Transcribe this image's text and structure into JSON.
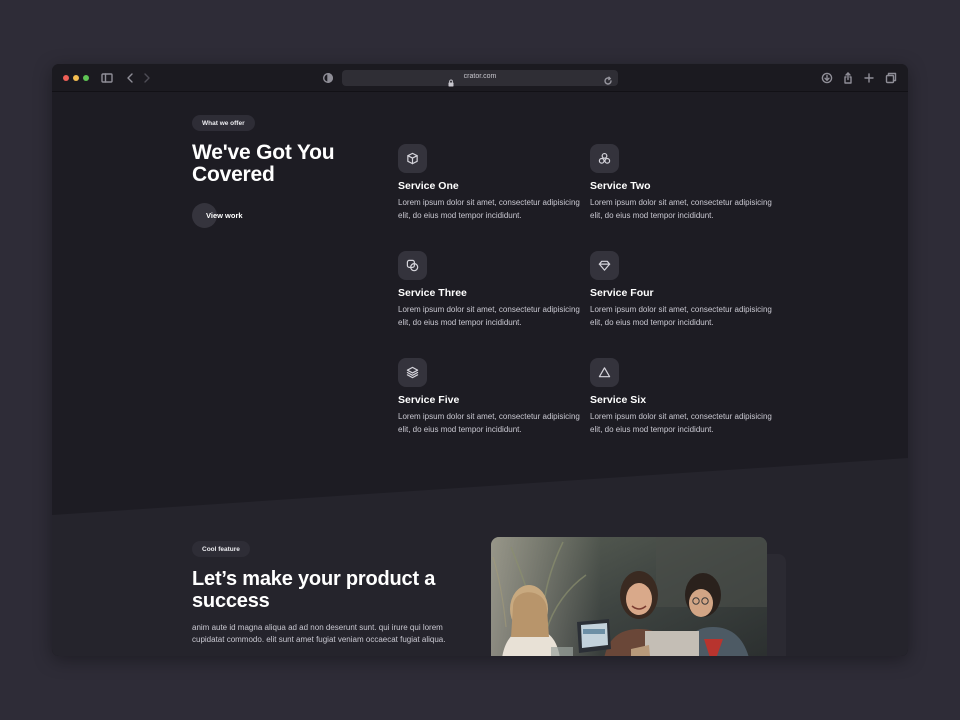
{
  "browser": {
    "url": "crator.com"
  },
  "hero": {
    "tag": "What we offer",
    "title": "We've Got You Covered",
    "button_label": "View work"
  },
  "services": [
    {
      "icon": "box-icon",
      "title": "Service One",
      "description": "Lorem ipsum dolor sit amet, consectetur adipisicing elit, do eius mod tempor incididunt."
    },
    {
      "icon": "circles-icon",
      "title": "Service Two",
      "description": "Lorem ipsum dolor sit amet, consectetur adipisicing elit, do eius mod tempor incididunt."
    },
    {
      "icon": "overlap-squares-icon",
      "title": "Service Three",
      "description": "Lorem ipsum dolor sit amet, consectetur adipisicing elit, do eius mod tempor incididunt."
    },
    {
      "icon": "diamond-icon",
      "title": "Service Four",
      "description": "Lorem ipsum dolor sit amet, consectetur adipisicing elit, do eius mod tempor incididunt."
    },
    {
      "icon": "layers-icon",
      "title": "Service Five",
      "description": "Lorem ipsum dolor sit amet, consectetur adipisicing elit, do eius mod tempor incididunt."
    },
    {
      "icon": "triangle-icon",
      "title": "Service Six",
      "description": "Lorem ipsum dolor sit amet, consectetur adipisicing elit, do eius mod tempor incididunt."
    }
  ],
  "feature": {
    "tag": "Cool feature",
    "title": "Let’s make your product a success",
    "body": "anim aute id magna aliqua ad ad non deserunt sunt. qui irure qui lorem cupidatat commodo. elit sunt amet fugiat veniam occaecat fugiat aliqua."
  },
  "colors": {
    "page_background": "#2e2c37",
    "section_dark": "#1d1c23",
    "section_light": "#25242c",
    "icon_tile": "#34333c"
  }
}
